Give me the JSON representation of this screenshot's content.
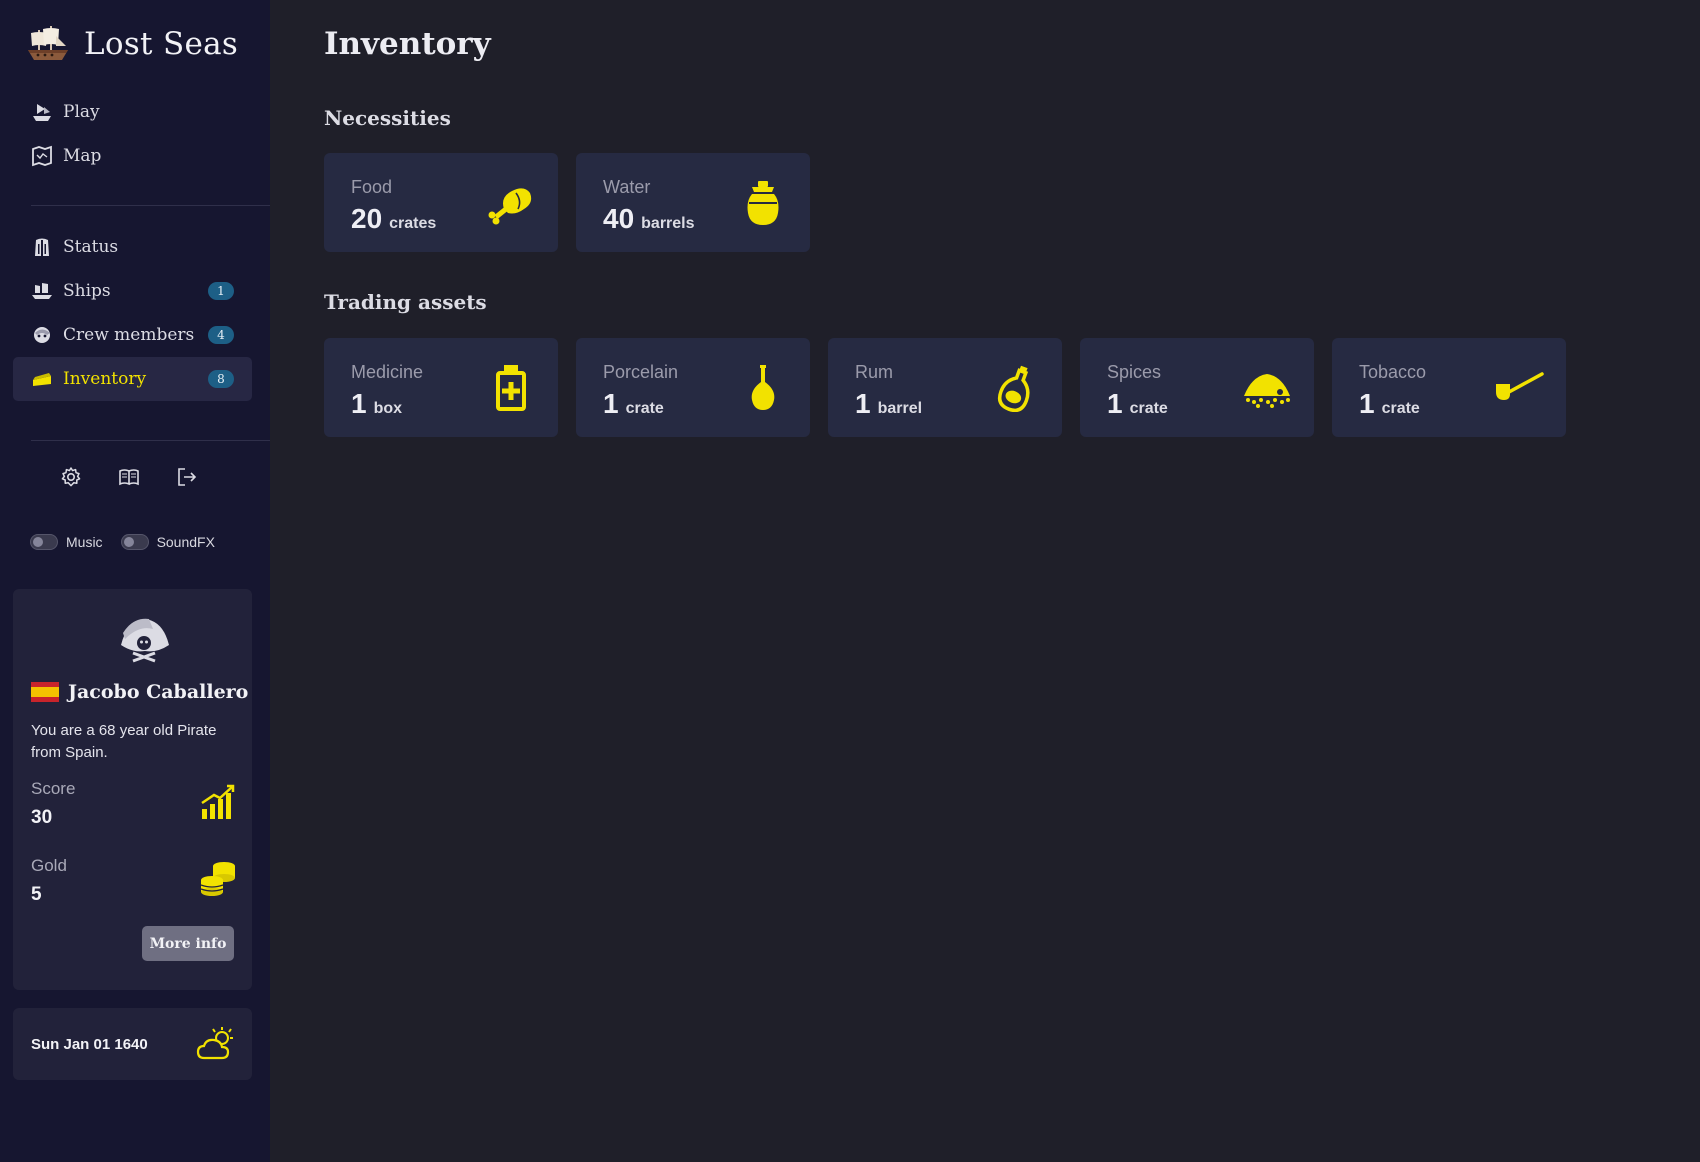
{
  "app": {
    "title": "Lost Seas"
  },
  "nav": {
    "primary": [
      {
        "label": "Play",
        "icon": "play-ship-icon"
      },
      {
        "label": "Map",
        "icon": "map-icon"
      }
    ],
    "secondary": [
      {
        "label": "Status",
        "icon": "status-icon",
        "badge": ""
      },
      {
        "label": "Ships",
        "icon": "ships-icon",
        "badge": "1"
      },
      {
        "label": "Crew members",
        "icon": "crew-icon",
        "badge": "4"
      },
      {
        "label": "Inventory",
        "icon": "inventory-icon",
        "badge": "8",
        "active": true
      }
    ]
  },
  "utility": {
    "icons": [
      "gear-icon",
      "book-icon",
      "logout-icon"
    ]
  },
  "toggles": {
    "music": "Music",
    "soundfx": "SoundFX"
  },
  "profile": {
    "name": "Jacobo Caballero",
    "description": "You are a 68 year old Pirate from Spain.",
    "score_label": "Score",
    "score_value": "30",
    "gold_label": "Gold",
    "gold_value": "5",
    "more_info": "More info"
  },
  "footer": {
    "date": "Sun Jan 01 1640",
    "weather_icon": "partly-cloudy-icon"
  },
  "page": {
    "title": "Inventory",
    "sections": [
      {
        "title": "Necessities",
        "items": [
          {
            "label": "Food",
            "value": "20",
            "unit": "crates",
            "icon": "meat-icon"
          },
          {
            "label": "Water",
            "value": "40",
            "unit": "barrels",
            "icon": "water-jug-icon"
          }
        ]
      },
      {
        "title": "Trading assets",
        "items": [
          {
            "label": "Medicine",
            "value": "1",
            "unit": "box",
            "icon": "medicine-icon"
          },
          {
            "label": "Porcelain",
            "value": "1",
            "unit": "crate",
            "icon": "vase-icon"
          },
          {
            "label": "Rum",
            "value": "1",
            "unit": "barrel",
            "icon": "rum-bottle-icon"
          },
          {
            "label": "Spices",
            "value": "1",
            "unit": "crate",
            "icon": "spice-pile-icon"
          },
          {
            "label": "Tobacco",
            "value": "1",
            "unit": "crate",
            "icon": "pipe-icon"
          }
        ]
      }
    ]
  },
  "colors": {
    "accent": "#f2e200",
    "sidebar": "#161630",
    "background": "#1f1f29",
    "card": "#262a42",
    "badge": "#1d5f86"
  }
}
